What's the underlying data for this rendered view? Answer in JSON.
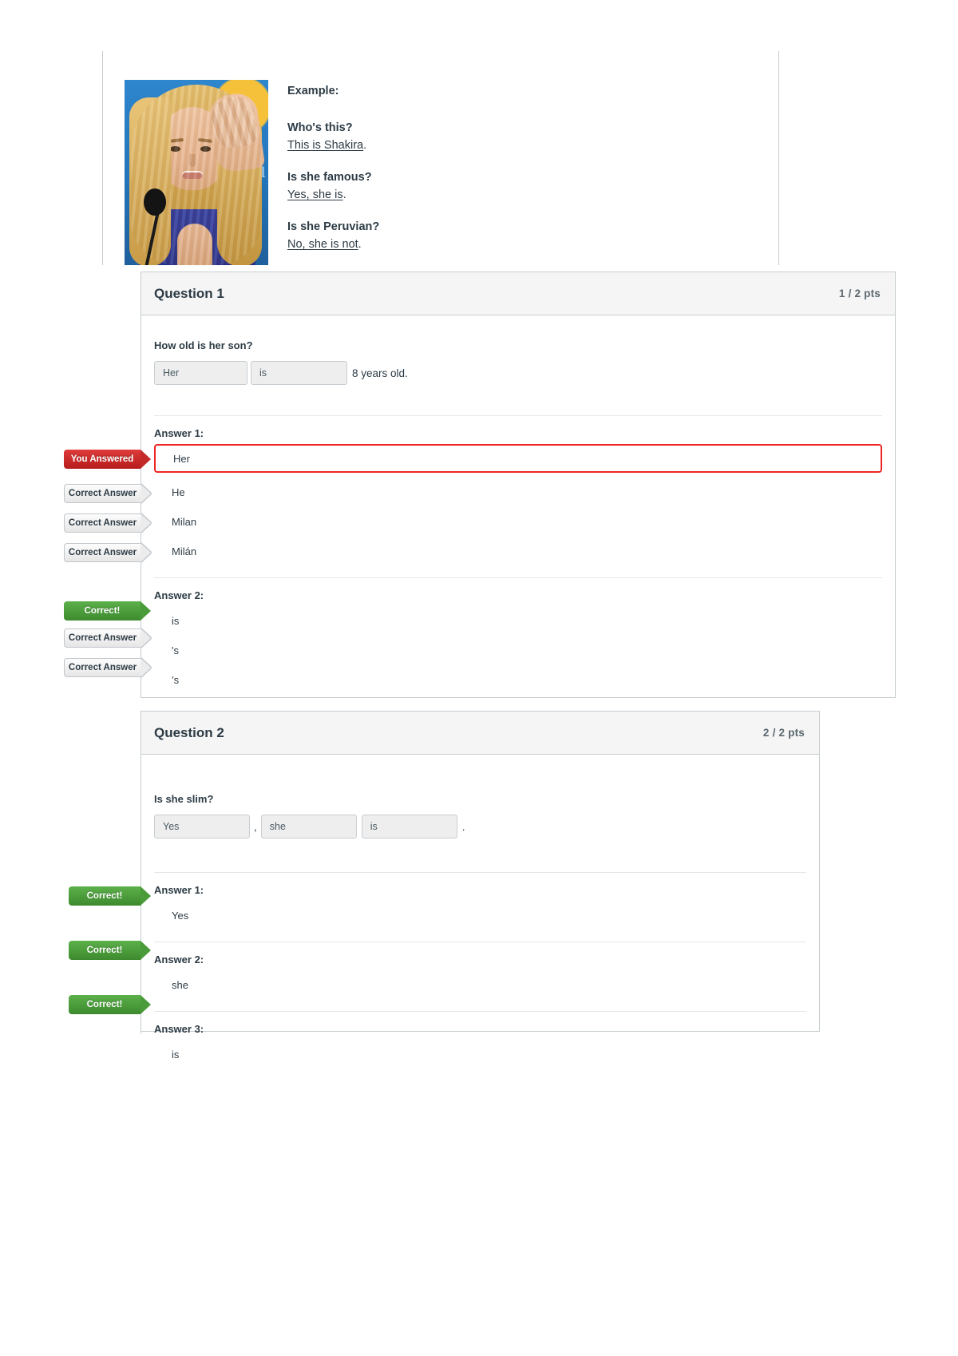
{
  "example": {
    "heading": "Example:",
    "image_alt": "shakira-photo",
    "pairs": [
      {
        "question": "Who's this?",
        "answer": "This is Shakira",
        "punct": "."
      },
      {
        "question": "Is she famous?",
        "answer": "Yes, she is",
        "punct": "."
      },
      {
        "question": "Is she Peruvian?",
        "answer": "No, she is not",
        "punct": "."
      }
    ]
  },
  "questions": [
    {
      "title": "Question 1",
      "points": "1 / 2 pts",
      "prompt": "How old is her son?",
      "blanks": [
        {
          "value": "Her"
        },
        {
          "value": "is"
        }
      ],
      "sentence_tail": "8 years old.",
      "separator": "",
      "answers": [
        {
          "label": "Answer 1:",
          "rows": [
            {
              "badge": "You Answered",
              "badge_type": "red",
              "value": "Her",
              "selected": true
            },
            {
              "badge": "Correct Answer",
              "badge_type": "gray",
              "value": "He",
              "selected": false
            },
            {
              "badge": "Correct Answer",
              "badge_type": "gray",
              "value": "Milan",
              "selected": false
            },
            {
              "badge": "Correct Answer",
              "badge_type": "gray",
              "value": "Milán",
              "selected": false
            }
          ]
        },
        {
          "label": "Answer 2:",
          "rows": [
            {
              "badge": "Correct!",
              "badge_type": "green",
              "value": "is",
              "selected": false
            },
            {
              "badge": "Correct Answer",
              "badge_type": "gray",
              "value": "'s",
              "selected": false
            },
            {
              "badge": "Correct Answer",
              "badge_type": "gray",
              "value": "’s",
              "selected": false
            }
          ]
        }
      ]
    },
    {
      "title": "Question 2",
      "points": "2 / 2 pts",
      "prompt": "Is she slim?",
      "blanks": [
        {
          "value": "Yes"
        },
        {
          "value": "she"
        },
        {
          "value": "is"
        }
      ],
      "sentence_tail": ".",
      "separator": ",",
      "answers": [
        {
          "label": "Answer 1:",
          "rows": [
            {
              "badge": "Correct!",
              "badge_type": "green",
              "value": "Yes",
              "selected": false
            }
          ]
        },
        {
          "label": "Answer 2:",
          "rows": [
            {
              "badge": "Correct!",
              "badge_type": "green",
              "value": "she",
              "selected": false
            }
          ]
        },
        {
          "label": "Answer 3:",
          "rows": [
            {
              "badge": "Correct!",
              "badge_type": "green",
              "value": "is",
              "selected": false
            }
          ]
        }
      ]
    }
  ],
  "colors": {
    "incorrect": "#ee2524",
    "correct": "#3d8a2e",
    "border": "#c7cdd1",
    "text": "#2d3b45"
  }
}
